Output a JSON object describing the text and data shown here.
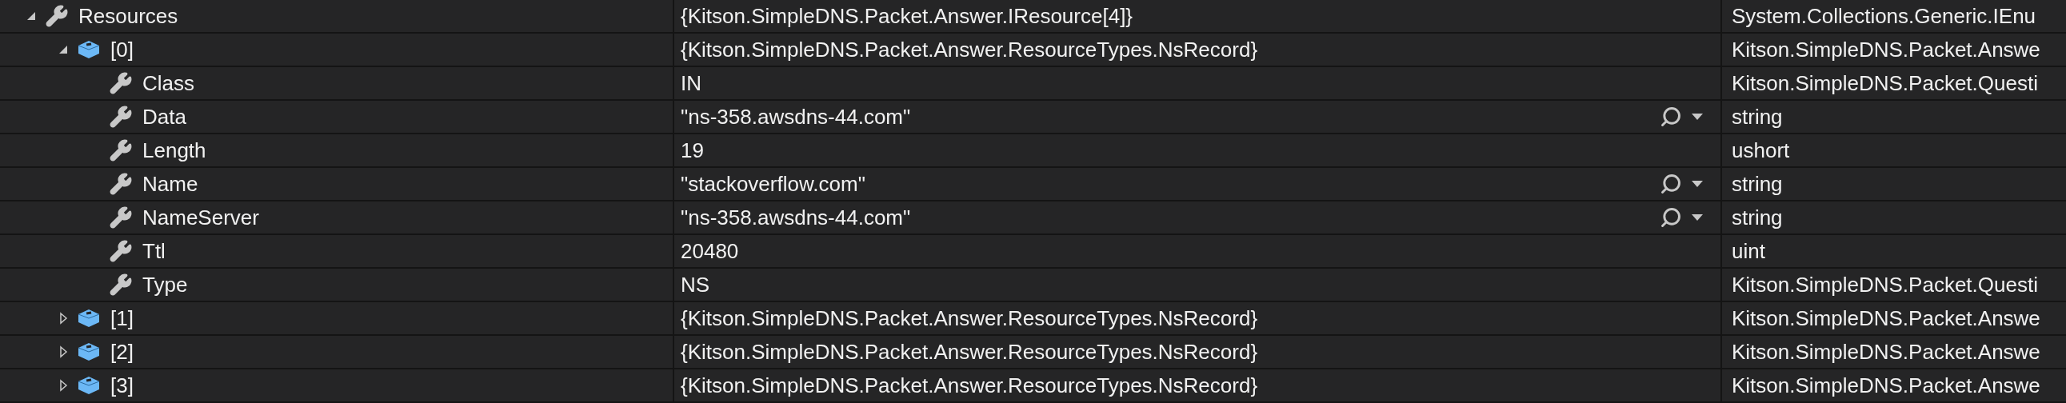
{
  "rows": [
    {
      "name": "Resources",
      "value": "{Kitson.SimpleDNS.Packet.Answer.IResource[4]}",
      "type": "System.Collections.Generic.IEnu",
      "kind": "property",
      "expanded": true,
      "visualizer": false,
      "children": [
        {
          "name": "[0]",
          "value": "{Kitson.SimpleDNS.Packet.Answer.ResourceTypes.NsRecord}",
          "type": "Kitson.SimpleDNS.Packet.Answe",
          "kind": "object",
          "expanded": true,
          "visualizer": false,
          "children": [
            {
              "name": "Class",
              "value": "IN",
              "type": "Kitson.SimpleDNS.Packet.Questi",
              "kind": "property",
              "visualizer": false
            },
            {
              "name": "Data",
              "value": "\"ns-358.awsdns-44.com\"",
              "type": "string",
              "kind": "property",
              "visualizer": true
            },
            {
              "name": "Length",
              "value": "19",
              "type": "ushort",
              "kind": "property",
              "visualizer": false
            },
            {
              "name": "Name",
              "value": "\"stackoverflow.com\"",
              "type": "string",
              "kind": "property",
              "visualizer": true
            },
            {
              "name": "NameServer",
              "value": "\"ns-358.awsdns-44.com\"",
              "type": "string",
              "kind": "property",
              "visualizer": true
            },
            {
              "name": "Ttl",
              "value": "20480",
              "type": "uint",
              "kind": "property",
              "visualizer": false
            },
            {
              "name": "Type",
              "value": "NS",
              "type": "Kitson.SimpleDNS.Packet.Questi",
              "kind": "property",
              "visualizer": false
            }
          ]
        },
        {
          "name": "[1]",
          "value": "{Kitson.SimpleDNS.Packet.Answer.ResourceTypes.NsRecord}",
          "type": "Kitson.SimpleDNS.Packet.Answe",
          "kind": "object",
          "expanded": false,
          "visualizer": false
        },
        {
          "name": "[2]",
          "value": "{Kitson.SimpleDNS.Packet.Answer.ResourceTypes.NsRecord}",
          "type": "Kitson.SimpleDNS.Packet.Answe",
          "kind": "object",
          "expanded": false,
          "visualizer": false
        },
        {
          "name": "[3]",
          "value": "{Kitson.SimpleDNS.Packet.Answer.ResourceTypes.NsRecord}",
          "type": "Kitson.SimpleDNS.Packet.Answe",
          "kind": "object",
          "expanded": false,
          "visualizer": false
        }
      ]
    }
  ]
}
